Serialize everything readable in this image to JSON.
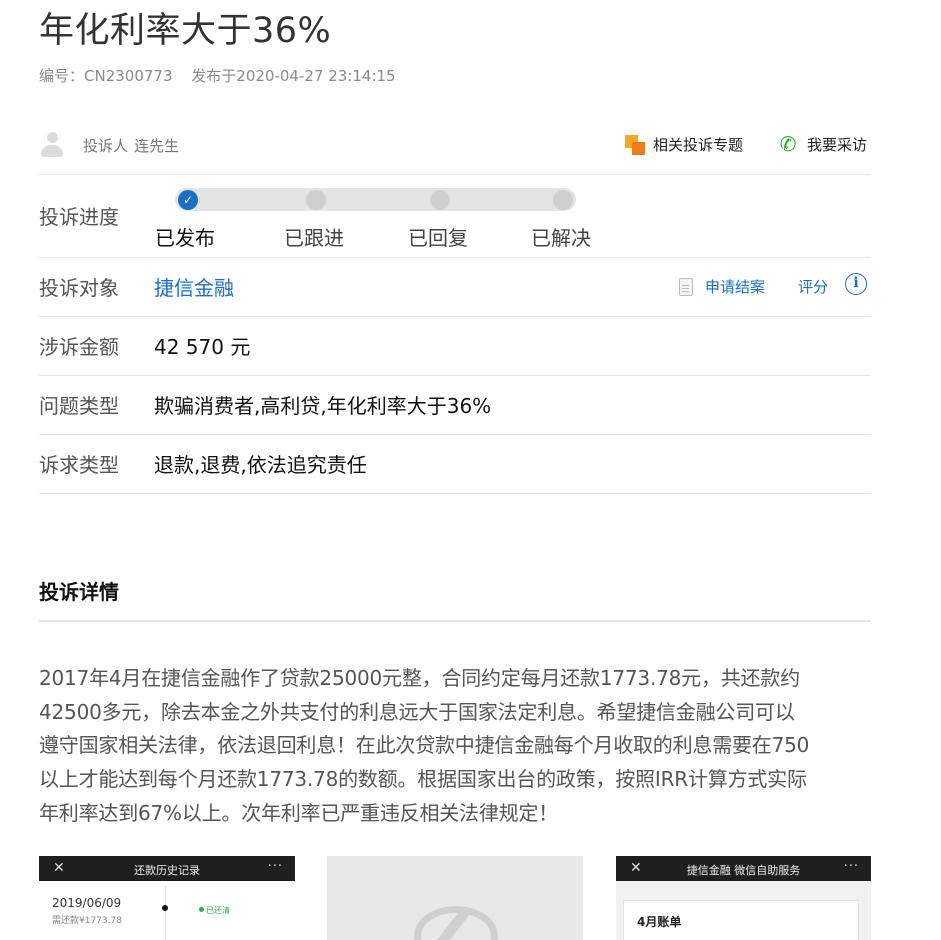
{
  "title": "年化利率大于36%",
  "meta": {
    "number": "编号：CN2300773",
    "published": "发布于2020-04-27 23:14:15"
  },
  "complainant": {
    "label": "投诉人",
    "name": "连先生"
  },
  "header_links": {
    "topic": "相关投诉专题",
    "interview": "我要采访"
  },
  "progress": {
    "label": "投诉进度",
    "steps": [
      {
        "label": "已发布",
        "done": true
      },
      {
        "label": "已跟进",
        "done": false
      },
      {
        "label": "已回复",
        "done": false
      },
      {
        "label": "已解决",
        "done": false
      }
    ]
  },
  "target": {
    "label": "投诉对象",
    "value": "捷信金融",
    "apply_close": "申请结案",
    "rate": "评分"
  },
  "amount": {
    "label": "涉诉金额",
    "value": "42 570 元"
  },
  "issue_type": {
    "label": "问题类型",
    "value": "欺骗消费者,高利贷,年化利率大于36%"
  },
  "claim_type": {
    "label": "诉求类型",
    "value": "退款,退费,依法追究责任"
  },
  "details": {
    "heading": "投诉详情",
    "lines": [
      "2017年4月在捷信金融作了贷款25000元整，合同约定每月还款1773.78元，共还款约",
      "42500多元，除去本金之外共支付的利息远大于国家法定利息。希望捷信金融公司可以",
      "遵守国家相关法律，依法退回利息！在此次贷款中捷信金融每个月收取的利息需要在750",
      "以上才能达到每个月还款1773.78的数额。根据国家出台的政策，按照IRR计算方式实际",
      "年利率达到67%以上。次年利率已严重违反相关法律规定！"
    ]
  },
  "attachments": {
    "shot1": {
      "close": "✕",
      "title": "还款历史记录",
      "more": "···",
      "date": "2019/06/09",
      "due": "需还款¥1773.78",
      "status": "已还清"
    },
    "shot3": {
      "close": "✕",
      "title": "捷信金融 微信自助服务",
      "more": "···",
      "card_title": "4月账单"
    }
  },
  "colors": {
    "link": "#1a6fc4",
    "phone_icon": "#1aad19",
    "topic_icon": "#f07a1c",
    "divider": "#e6e6e6"
  }
}
